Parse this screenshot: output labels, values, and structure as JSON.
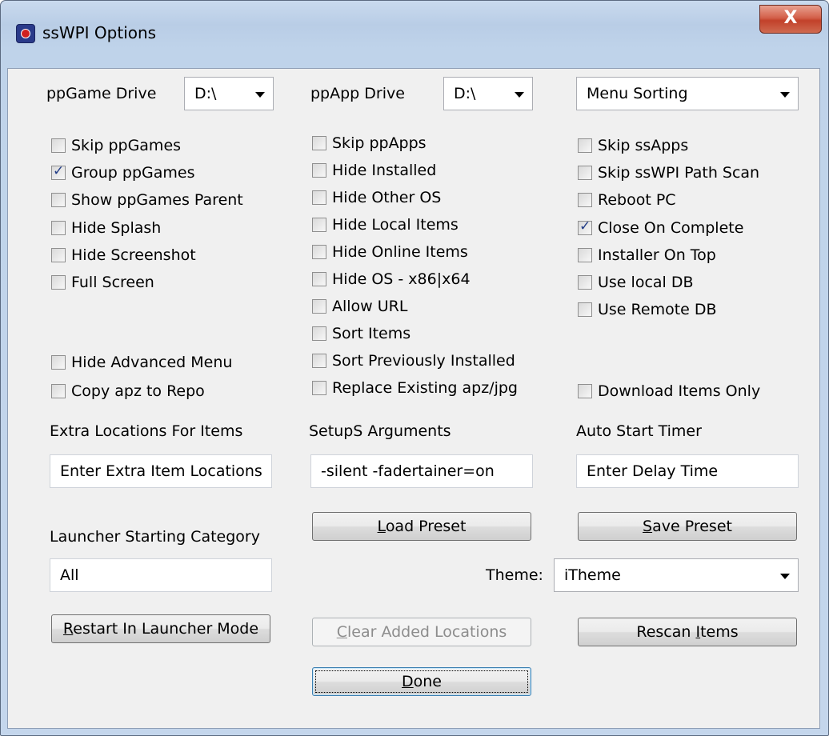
{
  "window": {
    "title": "ssWPI Options",
    "close_glyph": "X",
    "icon": "app-icon"
  },
  "drives": {
    "ppgame_label": "ppGame Drive",
    "ppgame_value": "D:\\",
    "ppapp_label": "ppApp Drive",
    "ppapp_value": "D:\\",
    "menu_sorting_value": "Menu Sorting"
  },
  "col1": [
    {
      "label": "Skip ppGames",
      "checked": false
    },
    {
      "label": "Group ppGames",
      "checked": true
    },
    {
      "label": "Show ppGames Parent",
      "checked": false
    },
    {
      "label": "Hide Splash",
      "checked": false
    },
    {
      "label": "Hide Screenshot",
      "checked": false
    },
    {
      "label": "Full Screen",
      "checked": false
    },
    {
      "label": "Hide Advanced Menu",
      "checked": false
    },
    {
      "label": "Copy apz to Repo",
      "checked": false
    }
  ],
  "col2": [
    {
      "label": "Skip ppApps",
      "checked": false
    },
    {
      "label": "Hide Installed",
      "checked": false
    },
    {
      "label": "Hide Other OS",
      "checked": false
    },
    {
      "label": "Hide Local Items",
      "checked": false
    },
    {
      "label": "Hide Online Items",
      "checked": false
    },
    {
      "label": "Hide OS - x86|x64",
      "checked": false
    },
    {
      "label": "Allow URL",
      "checked": false
    },
    {
      "label": "Sort Items",
      "checked": false
    },
    {
      "label": "Sort Previously Installed",
      "checked": false
    },
    {
      "label": "Replace Existing apz/jpg",
      "checked": false
    }
  ],
  "col3": [
    {
      "label": "Skip ssApps",
      "checked": false
    },
    {
      "label": "Skip ssWPI Path Scan",
      "checked": false
    },
    {
      "label": "Reboot PC",
      "checked": false
    },
    {
      "label": "Close On Complete",
      "checked": true
    },
    {
      "label": "Installer On Top",
      "checked": false
    },
    {
      "label": "Use local DB",
      "checked": false
    },
    {
      "label": "Use Remote DB",
      "checked": false
    },
    {
      "label": "Download Items Only",
      "checked": false
    }
  ],
  "fields": {
    "extra_locations_label": "Extra Locations For Items",
    "extra_locations_value": "Enter Extra Item Locations",
    "setups_args_label": "SetupS Arguments",
    "setups_args_value": "-silent -fadertainer=on",
    "auto_start_label": "Auto Start Timer",
    "auto_start_value": "Enter Delay Time",
    "launcher_category_label": "Launcher Starting Category",
    "launcher_category_value": "All",
    "theme_label": "Theme:",
    "theme_value": "iTheme"
  },
  "buttons": {
    "load_preset_accel": "L",
    "load_preset_rest": "oad Preset",
    "save_preset_accel": "S",
    "save_preset_rest": "ave Preset",
    "restart_accel": "R",
    "restart_rest": "estart In Launcher Mode",
    "clear_accel": "C",
    "clear_rest": "lear Added Locations",
    "rescan_pre": "Rescan ",
    "rescan_accel": "I",
    "rescan_rest": "tems",
    "done_accel": "D",
    "done_rest": "one"
  }
}
